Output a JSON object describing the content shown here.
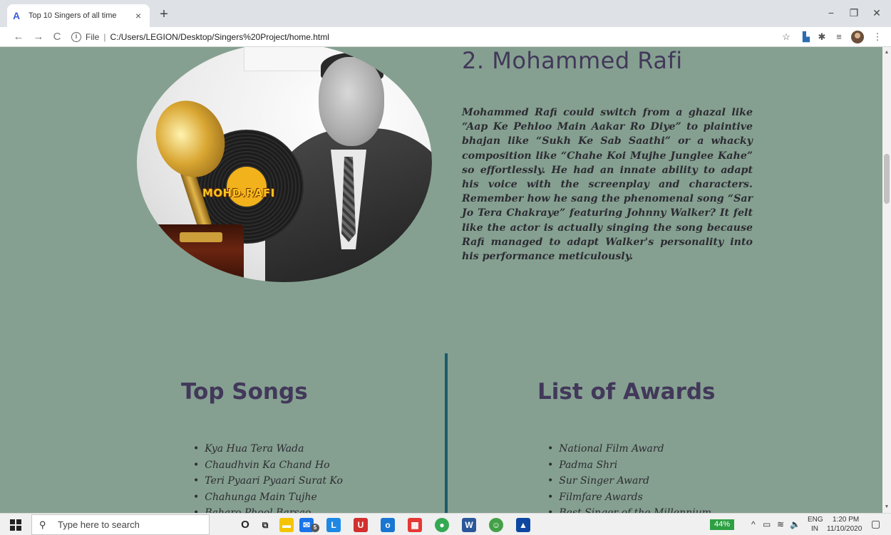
{
  "browser": {
    "tab_title": "Top 10 Singers of all time",
    "tab_close": "×",
    "new_tab": "+",
    "minimize": "−",
    "maximize": "❐",
    "close": "✕",
    "back": "←",
    "forward": "→",
    "reload": "C",
    "url_label": "File",
    "url_separator": "|",
    "url": "C:/Users/LEGION/Desktop/Singers%20Project/home.html"
  },
  "singer": {
    "name": "2. Mohammed Rafi",
    "image_caption": "MOHD.RAFI",
    "bio": "Mohammed Rafi could switch from a ghazal like “Aap Ke Pehloo Main Aakar Ro Diye” to plaintive bhajan like “Sukh Ke Sab Saathi” or a whacky composition like “Chahe Koi Mujhe Junglee Kahe” so effortlessly. He had an innate ability to adapt his voice with the screenplay and characters. Remember how he sang the phenomenal song “Sar Jo Tera Chakraye” featuring Johnny Walker? It felt like the actor is actually singing the song because Rafi managed to adapt Walker's personality into his performance meticulously."
  },
  "songs": {
    "title": "Top Songs",
    "items": [
      "Kya Hua Tera Wada",
      "Chaudhvin Ka Chand Ho",
      "Teri Pyaari Pyaari Surat Ko",
      "Chahunga Main Tujhe",
      "Baharo Phool Barsao"
    ]
  },
  "awards": {
    "title": "List of Awards",
    "items": [
      "National Film Award",
      "Padma Shri",
      "Sur Singer Award",
      "Filmfare Awards",
      "Best Singer of the Millennium"
    ]
  },
  "taskbar": {
    "search_placeholder": "Type here to search",
    "mail_badge": "5",
    "battery": "44%",
    "language_top": "ENG",
    "language_bottom": "IN",
    "time": "1:20 PM",
    "date": "11/10/2020"
  },
  "colors": {
    "page_background": "#85a090",
    "heading": "#42385a",
    "divider": "#1c5a6a"
  }
}
